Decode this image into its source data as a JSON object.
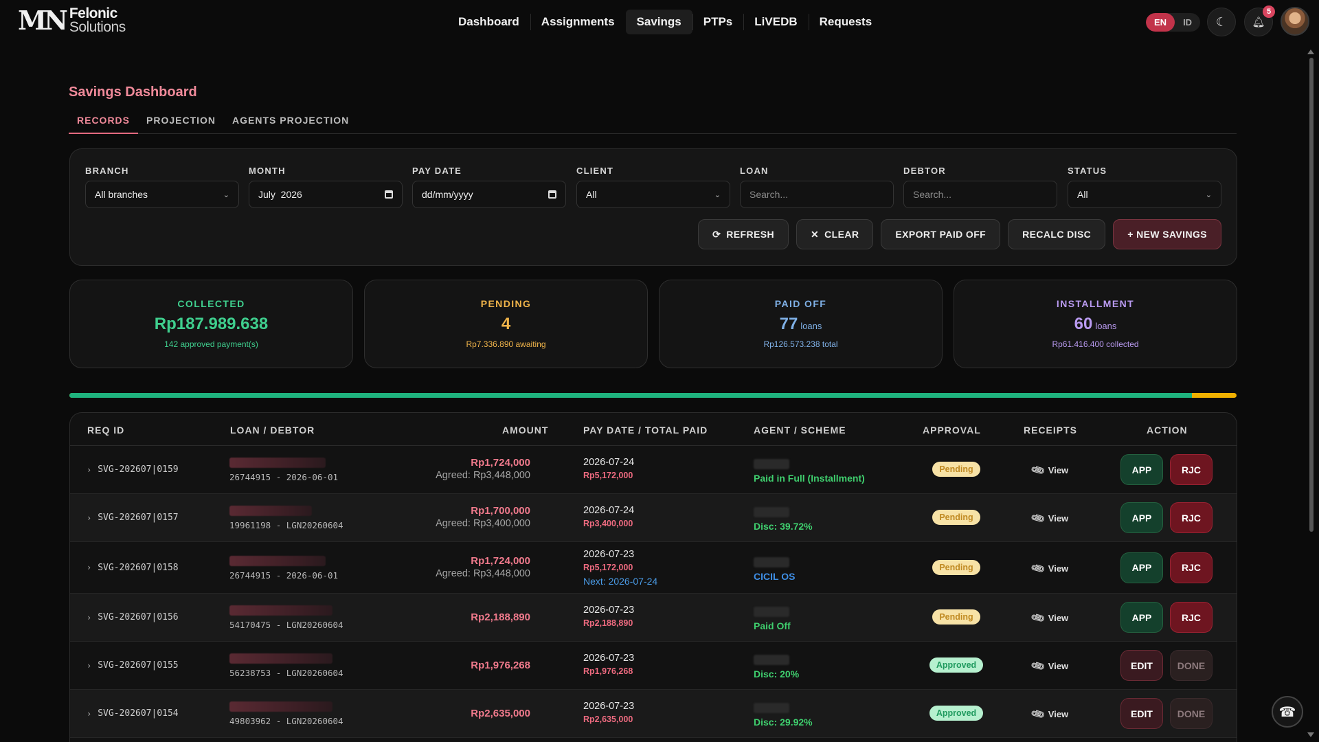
{
  "app": {
    "logo_mark": "MN",
    "logo_line1": "Felonic",
    "logo_line2": "Solutions"
  },
  "nav": {
    "items": [
      "Dashboard",
      "Assignments",
      "Savings",
      "PTPs",
      "LiVEDB",
      "Requests"
    ],
    "active": "Savings"
  },
  "header": {
    "lang_en": "EN",
    "lang_id": "ID",
    "notifications_count": "5",
    "theme_icon": "moon-icon",
    "bell_icon": "bell-icon"
  },
  "page": {
    "title": "Savings Dashboard",
    "tabs": [
      "RECORDS",
      "PROJECTION",
      "AGENTS PROJECTION"
    ],
    "active_tab": "RECORDS"
  },
  "filters": {
    "branch": {
      "label": "BRANCH",
      "value": "All branches"
    },
    "month": {
      "label": "MONTH",
      "value": "July  2026"
    },
    "pay_date": {
      "label": "PAY DATE",
      "placeholder": "dd/mm/yyyy"
    },
    "client": {
      "label": "CLIENT",
      "value": "All"
    },
    "loan": {
      "label": "LOAN",
      "placeholder": "Search..."
    },
    "debtor": {
      "label": "DEBTOR",
      "placeholder": "Search..."
    },
    "status": {
      "label": "STATUS",
      "value": "All"
    }
  },
  "actions": {
    "refresh": "REFRESH",
    "clear": "CLEAR",
    "export": "EXPORT PAID OFF",
    "recalc": "RECALC DISC",
    "new": "+ NEW SAVINGS"
  },
  "stats": {
    "collected": {
      "label": "COLLECTED",
      "value": "Rp187.989.638",
      "sub": "142 approved payment(s)",
      "color": "#3fcf8e"
    },
    "pending": {
      "label": "PENDING",
      "value": "4",
      "sub": "Rp7.336.890 awaiting",
      "color": "#f0b44a"
    },
    "paid_off": {
      "label": "PAID OFF",
      "value": "77",
      "unit": "loans",
      "sub": "Rp126.573.238 total",
      "color": "#7fb0e6"
    },
    "installment": {
      "label": "INSTALLMENT",
      "value": "60",
      "unit": "loans",
      "sub": "Rp61.416.400 collected",
      "color": "#b99af0"
    }
  },
  "progress": {
    "fraction": 0.962
  },
  "table": {
    "headers": {
      "req_id": "REQ ID",
      "loan": "LOAN / DEBTOR",
      "amount": "AMOUNT",
      "pay": "PAY DATE / TOTAL PAID",
      "agent": "AGENT / SCHEME",
      "approval": "APPROVAL",
      "receipts": "RECEIPTS",
      "action": "ACTION"
    },
    "view_label": "View",
    "rows": [
      {
        "req": "SVG-202607|0159",
        "loan": "26744915 - 2026-06-01",
        "amount": "Rp1,724,000",
        "agreed": "Agreed: Rp3,448,000",
        "date": "2026-07-24",
        "total": "Rp5,172,000",
        "next": "",
        "scheme": "Paid in Full (Installment)",
        "scheme_color": "#3fcf6e",
        "status": "Pending",
        "btn1": "APP",
        "btn2": "RJC"
      },
      {
        "req": "SVG-202607|0157",
        "loan": "19961198 - LGN20260604",
        "amount": "Rp1,700,000",
        "agreed": "Agreed: Rp3,400,000",
        "date": "2026-07-24",
        "total": "Rp3,400,000",
        "next": "",
        "scheme": "Disc: 39.72%",
        "scheme_color": "#3fcf6e",
        "status": "Pending",
        "btn1": "APP",
        "btn2": "RJC"
      },
      {
        "req": "SVG-202607|0158",
        "loan": "26744915 - 2026-06-01",
        "amount": "Rp1,724,000",
        "agreed": "Agreed: Rp3,448,000",
        "date": "2026-07-23",
        "total": "Rp5,172,000",
        "next": "Next: 2026-07-24",
        "scheme": "CICIL OS",
        "scheme_color": "#3f8fe6",
        "status": "Pending",
        "btn1": "APP",
        "btn2": "RJC"
      },
      {
        "req": "SVG-202607|0156",
        "loan": "54170475 - LGN20260604",
        "amount": "Rp2,188,890",
        "agreed": "",
        "date": "2026-07-23",
        "total": "Rp2,188,890",
        "next": "",
        "scheme": "Paid Off",
        "scheme_color": "#3fcf6e",
        "status": "Pending",
        "btn1": "APP",
        "btn2": "RJC"
      },
      {
        "req": "SVG-202607|0155",
        "loan": "56238753 - LGN20260604",
        "amount": "Rp1,976,268",
        "agreed": "",
        "date": "2026-07-23",
        "total": "Rp1,976,268",
        "next": "",
        "scheme": "Disc: 20%",
        "scheme_color": "#3fcf6e",
        "status": "Approved",
        "btn1": "EDIT",
        "btn2": "DONE"
      },
      {
        "req": "SVG-202607|0154",
        "loan": "49803962 - LGN20260604",
        "amount": "Rp2,635,000",
        "agreed": "",
        "date": "2026-07-23",
        "total": "Rp2,635,000",
        "next": "",
        "scheme": "Disc: 29.92%",
        "scheme_color": "#3fcf6e",
        "status": "Approved",
        "btn1": "EDIT",
        "btn2": "DONE"
      }
    ]
  }
}
